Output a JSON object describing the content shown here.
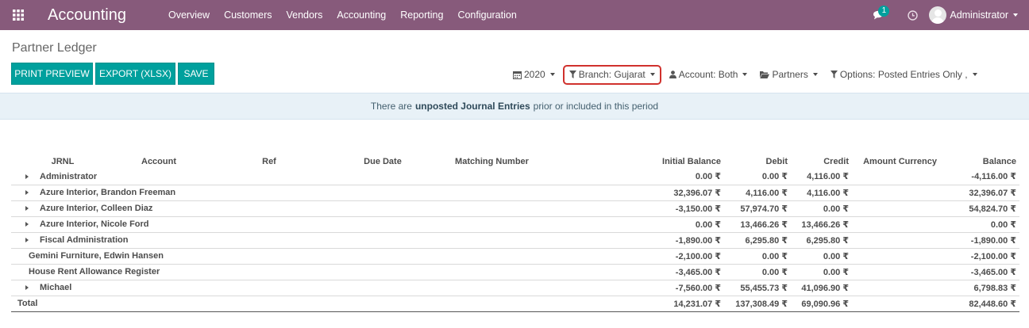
{
  "navbar": {
    "app_title": "Accounting",
    "menu": [
      "Overview",
      "Customers",
      "Vendors",
      "Accounting",
      "Reporting",
      "Configuration"
    ],
    "chat_count": "1",
    "user": "Administrator"
  },
  "page": {
    "title": "Partner Ledger"
  },
  "buttons": {
    "print_preview": "PRINT PREVIEW",
    "export": "EXPORT (XLSX)",
    "save": "SAVE"
  },
  "filters": {
    "year": "2020",
    "branch": "Branch: Gujarat",
    "account": "Account: Both",
    "partners": "Partners",
    "options": "Options: Posted Entries Only ,"
  },
  "alert": {
    "prefix": "There are",
    "bold": "unposted Journal Entries",
    "suffix": "prior or included in this period"
  },
  "table": {
    "headers": [
      "JRNL",
      "Account",
      "Ref",
      "Due Date",
      "Matching Number",
      "Initial Balance",
      "Debit",
      "Credit",
      "Amount Currency",
      "Balance"
    ],
    "rows": [
      {
        "name": "Administrator",
        "expandable": true,
        "initial": "0.00 ₹",
        "debit": "0.00 ₹",
        "credit": "4,116.00 ₹",
        "balance": "-4,116.00 ₹"
      },
      {
        "name": "Azure Interior, Brandon Freeman",
        "expandable": true,
        "initial": "32,396.07 ₹",
        "debit": "4,116.00 ₹",
        "credit": "4,116.00 ₹",
        "balance": "32,396.07 ₹"
      },
      {
        "name": "Azure Interior, Colleen Diaz",
        "expandable": true,
        "initial": "-3,150.00 ₹",
        "debit": "57,974.70 ₹",
        "credit": "0.00 ₹",
        "balance": "54,824.70 ₹"
      },
      {
        "name": "Azure Interior, Nicole Ford",
        "expandable": true,
        "initial": "0.00 ₹",
        "debit": "13,466.26 ₹",
        "credit": "13,466.26 ₹",
        "balance": "0.00 ₹"
      },
      {
        "name": "Fiscal Administration",
        "expandable": true,
        "initial": "-1,890.00 ₹",
        "debit": "6,295.80 ₹",
        "credit": "6,295.80 ₹",
        "balance": "-1,890.00 ₹"
      },
      {
        "name": "Gemini Furniture, Edwin Hansen",
        "expandable": false,
        "initial": "-2,100.00 ₹",
        "debit": "0.00 ₹",
        "credit": "0.00 ₹",
        "balance": "-2,100.00 ₹"
      },
      {
        "name": "House Rent Allowance Register",
        "expandable": false,
        "initial": "-3,465.00 ₹",
        "debit": "0.00 ₹",
        "credit": "0.00 ₹",
        "balance": "-3,465.00 ₹"
      },
      {
        "name": "Michael",
        "expandable": true,
        "initial": "-7,560.00 ₹",
        "debit": "55,455.73 ₹",
        "credit": "41,096.90 ₹",
        "balance": "6,798.83 ₹"
      }
    ],
    "total": {
      "name": "Total",
      "initial": "14,231.07 ₹",
      "debit": "137,308.49 ₹",
      "credit": "69,090.96 ₹",
      "balance": "82,448.60 ₹"
    }
  }
}
